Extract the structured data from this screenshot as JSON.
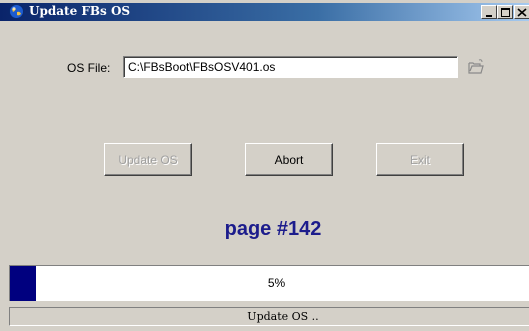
{
  "window": {
    "title": "Update FBs OS",
    "app_icon": "globe-icon",
    "controls": [
      "minimize-icon",
      "maximize-icon",
      "close-icon"
    ]
  },
  "os_file": {
    "label": "OS File:",
    "value": "C:\\FBsBoot\\FBsOSV401.os",
    "browse_icon": "folder-open-icon"
  },
  "buttons": {
    "update": {
      "label": "Update OS",
      "enabled": false
    },
    "abort": {
      "label": "Abort",
      "enabled": true
    },
    "exit": {
      "label": "Exit",
      "enabled": false
    }
  },
  "page_counter": "page #142",
  "progress": {
    "percent_text": "5%",
    "fraction": 0.05
  },
  "status": {
    "text": "Update OS .."
  },
  "colors": {
    "progress_fill": "#00007f",
    "page_counter": "#1c1c8c",
    "face": "#d4d0c8"
  }
}
